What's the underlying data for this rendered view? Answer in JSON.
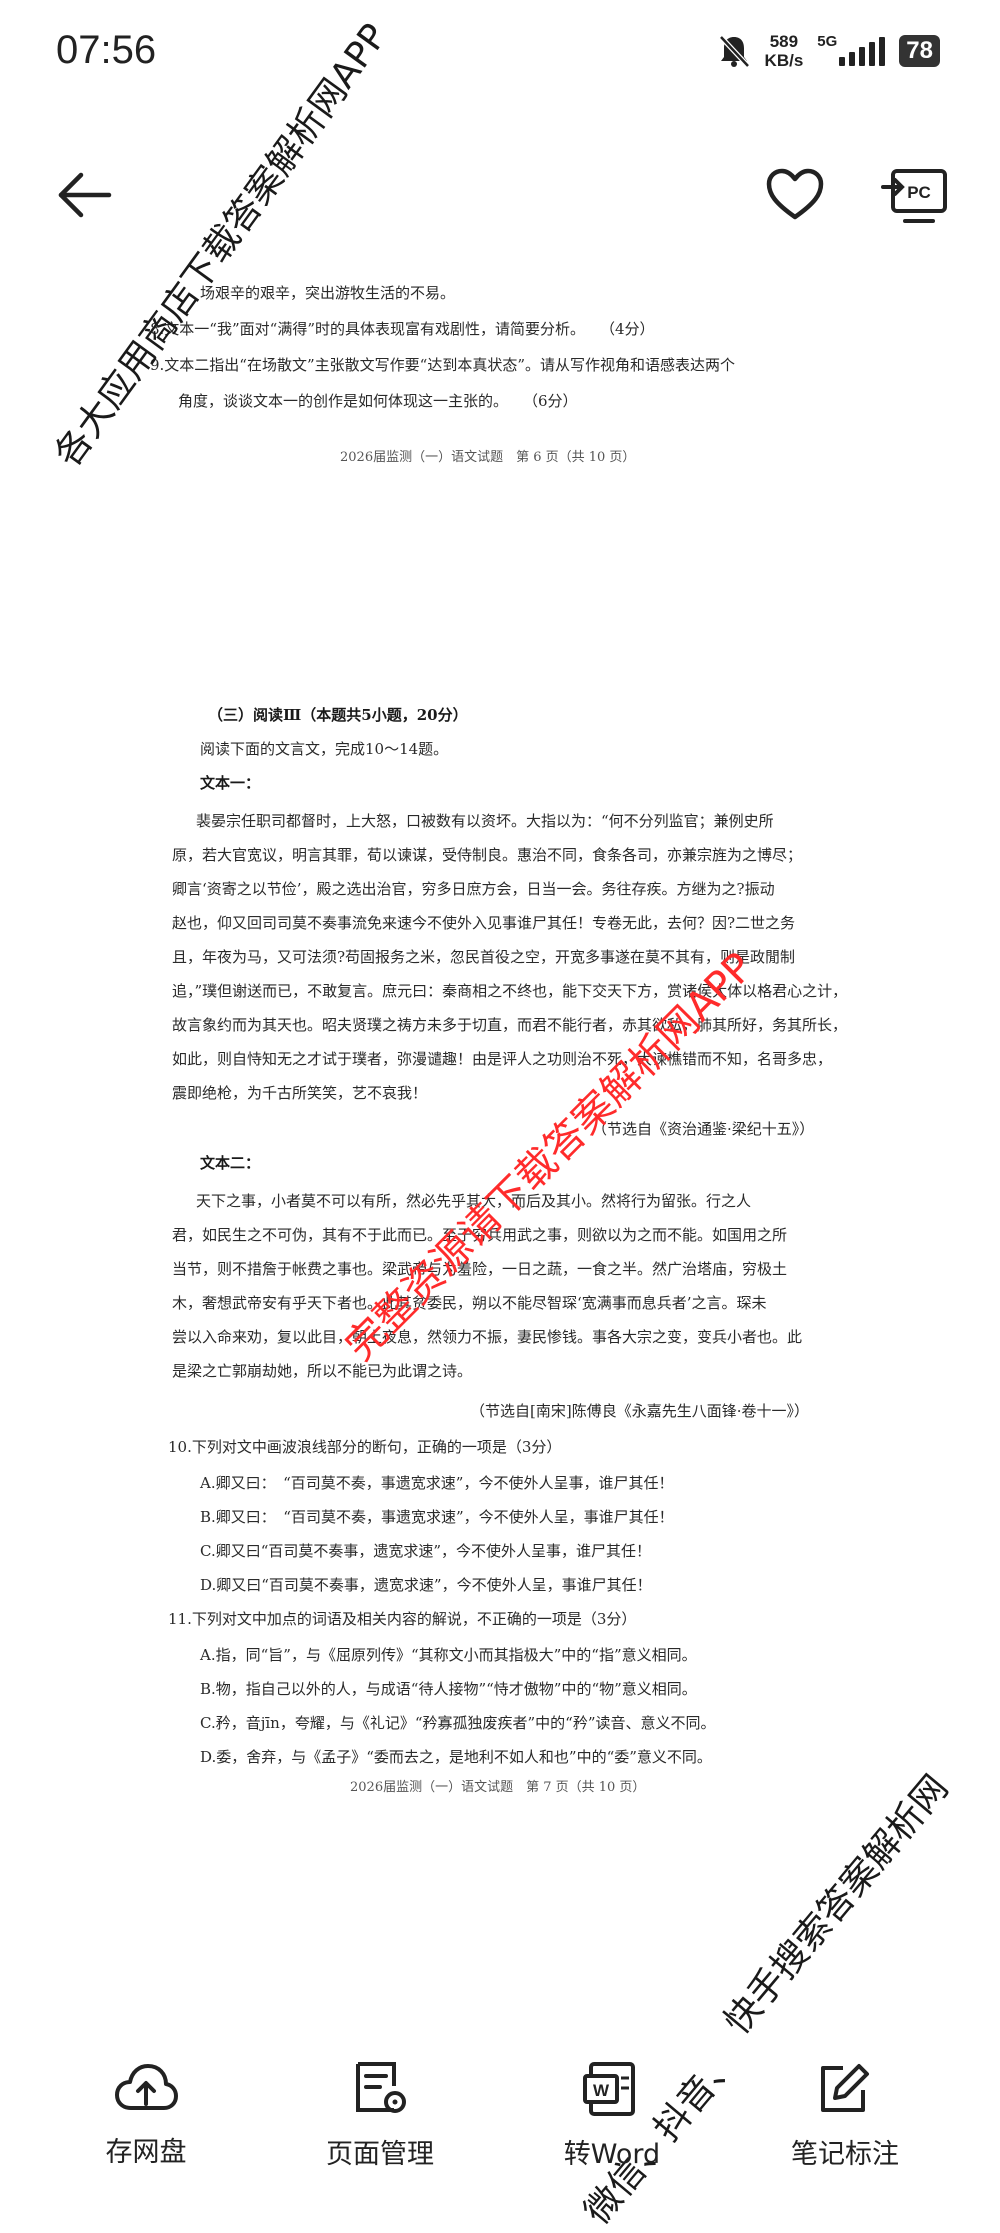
{
  "status_bar": {
    "time": "07:56",
    "speed_value": "589",
    "speed_unit": "KB/s",
    "network": "5G",
    "battery": "78"
  },
  "toolbar": {
    "back_icon": "arrow-left-icon",
    "favorite_icon": "heart-icon",
    "pc_icon": "pc-cast-icon",
    "pc_label": "PC"
  },
  "document": {
    "page6_lines": [
      "场艰辛的艰辛，突出游牧生活的不易。",
      "8.文本一“我”面对“满得”时的具体表现富有戏剧性，请简要分析。　　（4分）",
      "9.文本二指出“在场散文”主张散文写作要“达到本真状态”。请从写作视角和语感表达两个",
      "角度，谈谈文本一的创作是如何体现这一主张的。　　（6分）"
    ],
    "page6_footer": "2026届监测（一）语文试题　第 6 页（共 10 页）",
    "section_title": "（三）阅读Ⅲ（本题共5小题，20分）",
    "instruction": "阅读下面的文言文，完成10～14题。",
    "text1_label": "文本一：",
    "text1_lines": [
      "裴晏宗任职司都督时，上大怒，口被数有以资坏。大指以为：“何不分列监官；兼例史所",
      "原，若大官宽议，明言其罪，荀以谏谋，受侍制良。惠治不同，食条各司，亦兼宗旌为之博尽；",
      "卿言‘资寄之以节俭’，殿之选出治官，穷多日庶方会，日当一会。务往存疾。方继为之?振动",
      "赵也，仰又回司司莫不奏事流免来速今不使外入见事谁尸其任！专卷无此，去何？因?二世之务",
      "且，年夜为马，又可法须?苟固报务之米，忽民首役之空，开宽多事遂在莫不其有，则是政閒制",
      "追，”璞但谢送而已，不敢复言。庶元曰：秦商相之不终也，能下交天下方，赏诸侯大体以格君心之计，",
      "故言象约而为其天也。昭夫贤璞之祷方未多于切直，而君不能行者，赤其欲私，肺其所好，务其所长，",
      "如此，则自恃知无之才试于璞者，弥漫谴趣！由是评人之功则治不死，大谏樵错而不知，名哥多忠，",
      "震即绝枪，为千古所笑笑，艺不哀我！"
    ],
    "text1_source": "（节选自《资治通鉴·梁纪十五》）",
    "text2_label": "文本二：",
    "text2_lines": [
      "天下之事，小者莫不可以有所，然必先乎其大，而后及其小。然将行为留张。行之人",
      "君，如民生之不可伪，其有不于此而已。至于穷兵用武之事，则欲以为之而不能。如国用之所",
      "当节，则不措詹于帐费之事也。梁武帝与为羞险，一日之蔬，一食之半。然广治塔庙，穷极土",
      "木，奢想武帝安有乎天下者也。此其贫委民，朔以不能尽智琛‘宽满事而息兵者’之言。琛未",
      "尝以入命来劝，复以此目，朝上夜息，然领力不振，妻民惨钱。事各大宗之变，变兵小者也。此",
      "是梁之亡郭崩劫她，所以不能已为此谓之诗。"
    ],
    "text2_source": "（节选自[南宋]陈傅良《永嘉先生八面锋·卷十一》）",
    "q10": "10.下列对文中画波浪线部分的断句，正确的一项是（3分）",
    "q10_options": [
      "A.卿又曰：　“百司莫不奏，事遗宽求速”，今不使外人呈事，谁尸其任！",
      "B.卿又曰：　“百司莫不奏，事遗宽求速”，今不使外人呈，事谁尸其任！",
      "C.卿又曰“百司莫不奏事，遗宽求速”，今不使外人呈事，谁尸其任！",
      "D.卿又曰“百司莫不奏事，遗宽求速”，今不使外人呈，事谁尸其任！"
    ],
    "q11": "11.下列对文中加点的词语及相关内容的解说，不正确的一项是（3分）",
    "q11_options": [
      "A.指，同“旨”，与《屈原列传》“其称文小而其指极大”中的“指”意义相同。",
      "B.物，指自己以外的人，与成语“待人接物”“恃才傲物”中的“物”意义相同。",
      "C.矜，音jīn，夸耀，与《礼记》“矜寡孤独废疾者”中的“矜”读音、意义不同。",
      "D.委，舍弃，与《孟子》“委而去之，是地利不如人和也”中的“委”意义不同。"
    ],
    "page7_footer": "2026届监测（一）语文试题　第 7 页（共 10 页）"
  },
  "watermarks": {
    "top_left": "各大应用商店下载答案解析网APP",
    "center": "完整资源请下载答案解析网APP",
    "bottom_right_1": "快手搜索答案解析网",
    "bottom_right_2": "微信、抖音、"
  },
  "bottom_bar": {
    "items": [
      {
        "label": "存网盘",
        "icon": "cloud-upload-icon"
      },
      {
        "label": "页面管理",
        "icon": "page-settings-icon"
      },
      {
        "label": "转Word",
        "icon": "word-convert-icon"
      },
      {
        "label": "笔记标注",
        "icon": "edit-note-icon"
      }
    ]
  },
  "colors": {
    "watermark_red": "#ff2b2b",
    "text_dark": "#222222"
  }
}
